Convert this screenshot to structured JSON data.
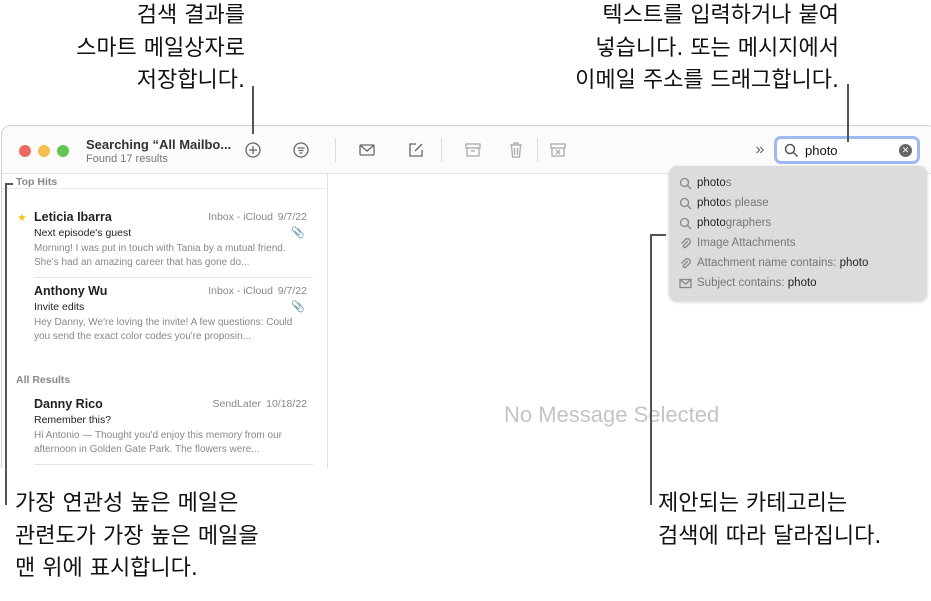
{
  "callouts": {
    "top_left": [
      "검색 결과를",
      "스마트 메일상자로",
      "저장합니다."
    ],
    "top_right": [
      "텍스트를 입력하거나 붙여",
      "넣습니다. 또는 메시지에서",
      "이메일 주소를 드래그합니다."
    ],
    "bottom_left": [
      "가장 연관성 높은 메일은",
      "관련도가 가장 높은 메일을",
      "맨 위에 표시합니다."
    ],
    "bottom_right": [
      "제안되는 카테고리는",
      "검색에 따라 달라집니다."
    ]
  },
  "window": {
    "title": "Searching “All Mailbo...",
    "subtitle": "Found 17 results",
    "toolbar_icons": [
      "add-smart-mailbox-icon",
      "filter-icon",
      "get-mail-icon",
      "compose-icon",
      "archive-icon",
      "trash-icon",
      "junk-icon",
      "more-icon"
    ],
    "search": {
      "value": "photo"
    },
    "colors": {
      "close": "#ed6a5e",
      "minimize": "#f5bf4f",
      "zoom": "#61c554",
      "search_focus": "#9fb8f2"
    }
  },
  "sidebar": {
    "top_hits_label": "Top Hits",
    "all_results_label": "All Results",
    "top_hits": [
      {
        "from": "Leticia Ibarra",
        "mailbox": "Inbox - iCloud",
        "date": "9/7/22",
        "subject": "Next episode's guest",
        "preview": "Morning! I was put in touch with Tania by a mutual friend. She's had an amazing career that has gone do...",
        "flagged": true,
        "attachment": true
      },
      {
        "from": "Anthony Wu",
        "mailbox": "Inbox - iCloud",
        "date": "9/7/22",
        "subject": "Invite edits",
        "preview": "Hey Danny, We're loving the invite! A few questions: Could you send the exact color codes you're proposin...",
        "flagged": false,
        "attachment": true
      }
    ],
    "all_results": [
      {
        "from": "Danny Rico",
        "mailbox": "SendLater",
        "date": "10/18/22",
        "subject": "Remember this?",
        "preview": "Hi Antonio — Thought you'd enjoy this memory from our afternoon in Golden Gate Park. The flowers were..."
      }
    ]
  },
  "main": {
    "empty_text": "No Message Selected"
  },
  "suggestions": [
    {
      "icon": "search-icon",
      "match": "photo",
      "rest": "s"
    },
    {
      "icon": "search-icon",
      "match": "photo",
      "rest": "s please"
    },
    {
      "icon": "search-icon",
      "match": "photo",
      "rest": "graphers"
    },
    {
      "icon": "paperclip-icon",
      "prefix": "Image Attachments",
      "value": ""
    },
    {
      "icon": "paperclip-icon",
      "prefix": "Attachment name contains: ",
      "value": "photo"
    },
    {
      "icon": "envelope-icon",
      "prefix": "Subject contains: ",
      "value": "photo"
    }
  ]
}
